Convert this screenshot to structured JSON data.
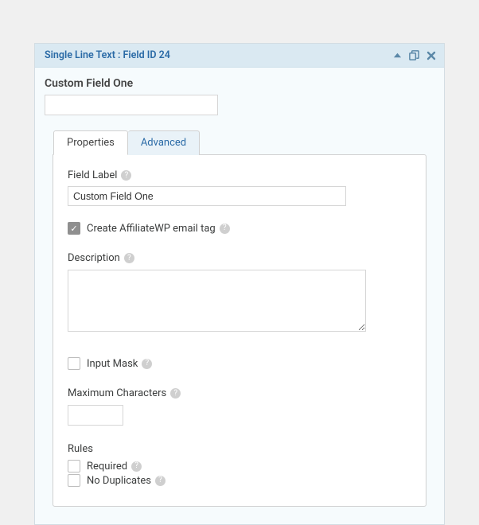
{
  "header": {
    "title": "Single Line Text : Field ID 24"
  },
  "preview": {
    "label": "Custom Field One"
  },
  "tabs": {
    "properties": "Properties",
    "advanced": "Advanced"
  },
  "props": {
    "field_label": {
      "label": "Field Label",
      "value": "Custom Field One"
    },
    "email_tag": {
      "checked": true,
      "label": "Create AffiliateWP email tag"
    },
    "description": {
      "label": "Description",
      "value": ""
    },
    "input_mask": {
      "checked": false,
      "label": "Input Mask"
    },
    "max_chars": {
      "label": "Maximum Characters",
      "value": ""
    },
    "rules": {
      "label": "Rules",
      "required": {
        "checked": false,
        "label": "Required"
      },
      "no_duplicates": {
        "checked": false,
        "label": "No Duplicates"
      }
    }
  }
}
